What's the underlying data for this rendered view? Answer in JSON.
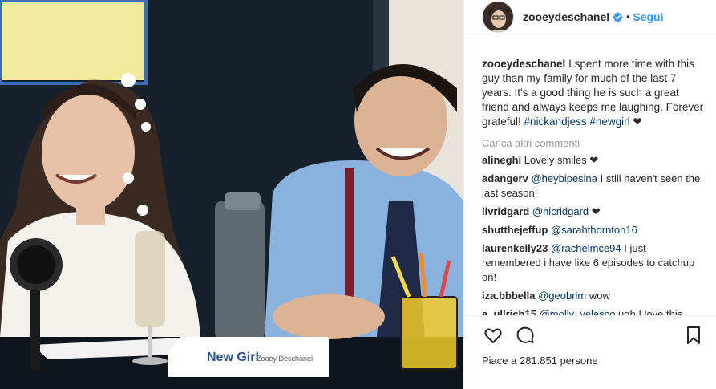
{
  "header": {
    "username": "zooeydeschanel",
    "separator": "•",
    "follow_label": "Segui"
  },
  "caption": {
    "username": "zooeydeschanel",
    "text": "I spent more time with this guy than my family for much of the last 7 years. It's a good thing he is such a great friend and always keeps me laughing. Forever grateful!",
    "hashtags": [
      "#nickandjess",
      "#newgirl"
    ],
    "trailing_emoji": "❤"
  },
  "load_more_label": "Carica altri commenti",
  "comments": [
    {
      "user": "alineghi",
      "mention": "",
      "text": "Lovely smiles ❤"
    },
    {
      "user": "adangerv",
      "mention": "@heybipesina",
      "text": "I still haven't seen the last season!"
    },
    {
      "user": "livridgard",
      "mention": "@nicridgard",
      "text": "❤"
    },
    {
      "user": "shutthejeffup",
      "mention": "@sarahthornton16",
      "text": ""
    },
    {
      "user": "laurenkelly23",
      "mention": "@rachelmce94",
      "text": "I just remembered i have like 6 episodes to catchup on!"
    },
    {
      "user": "iza.bbbella",
      "mention": "@geobrim",
      "text": "wow"
    },
    {
      "user": "a_ullrich15",
      "mention": "@molly_velasco",
      "text": "ugh I love this"
    }
  ],
  "likes_text": "Piace a 281.851 persone",
  "photo": {
    "card_label": "New Girl",
    "card_sublabel": "Zooey Deschanel"
  },
  "icons": {
    "like": "heart-icon",
    "comment": "comment-icon",
    "save": "bookmark-icon",
    "verified": "verified-badge-icon"
  },
  "colors": {
    "link": "#3897f0",
    "hashtag": "#003569",
    "muted": "#999999"
  }
}
